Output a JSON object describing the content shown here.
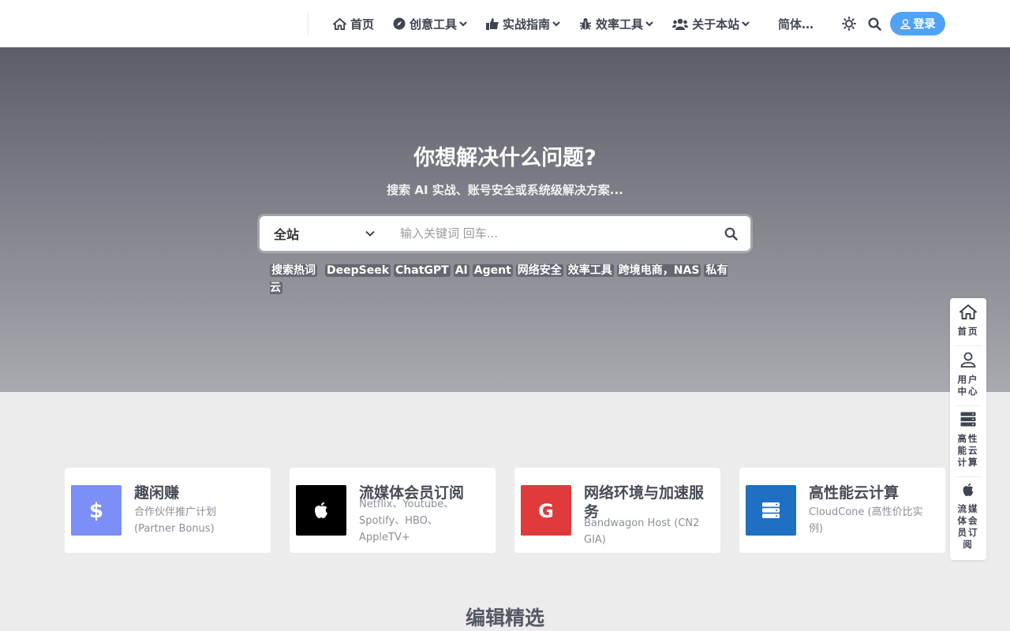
{
  "header": {
    "nav": [
      {
        "label": "首页",
        "icon": "home-icon"
      },
      {
        "label": "创意工具",
        "icon": "compass-icon"
      },
      {
        "label": "实战指南",
        "icon": "thumbs-up-icon"
      },
      {
        "label": "效率工具",
        "icon": "bug-icon"
      },
      {
        "label": "关于本站",
        "icon": "users-icon"
      }
    ],
    "language": "简体…",
    "login_label": "登录"
  },
  "hero": {
    "title": "你想解决什么问题?",
    "subtitle": "搜索 AI 实战、账号安全或系统级解决方案...",
    "search_scope": "全站",
    "search_placeholder": "输入关键词 回车...",
    "hot_label": "搜索热词",
    "hot_words": [
      "DeepSeek",
      "ChatGPT",
      "AI",
      "Agent",
      "网络安全",
      "效率工具",
      "跨境电商，NAS",
      "私有云"
    ]
  },
  "cards": [
    {
      "title": "趣闲赚",
      "desc": "合作伙伴推广计划 (Partner Bonus)",
      "icon": "dollar-icon",
      "color": "#7b8ff7"
    },
    {
      "title": "流媒体会员订阅",
      "desc": "Netflix、Youtube、Spotify、HBO、AppleTV+",
      "icon": "apple-icon",
      "color": "#000000"
    },
    {
      "title": "网络环境与加速服务",
      "desc": "Bandwagon Host (CN2 GIA)",
      "icon": "google-icon",
      "color": "#e03a3a"
    },
    {
      "title": "高性能云计算",
      "desc": "CloudCone (高性价比实例)",
      "icon": "server-icon",
      "color": "#1f6fc2"
    }
  ],
  "section_title": "编辑精选",
  "floatbar": [
    {
      "label": "首页",
      "icon": "home-icon"
    },
    {
      "label": "用户中心",
      "icon": "user-icon"
    },
    {
      "label": "高性能云计算",
      "icon": "server-icon"
    },
    {
      "label": "流媒体会员订阅",
      "icon": "apple-icon"
    }
  ]
}
